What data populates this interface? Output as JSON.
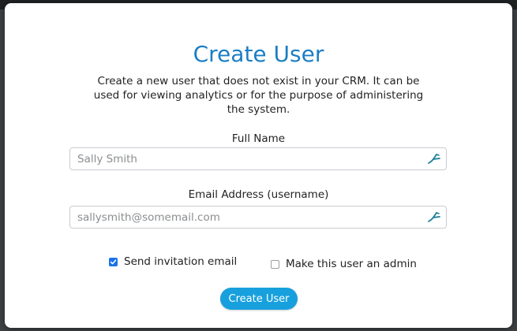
{
  "dialog": {
    "title": "Create User",
    "description": "Create a new user that does not exist in your CRM. It can be used for viewing analytics or for the purpose of administering the system."
  },
  "form": {
    "full_name": {
      "label": "Full Name",
      "placeholder": "Sally Smith",
      "value": "",
      "icon": "autofill-icon"
    },
    "email": {
      "label": "Email Address (username)",
      "placeholder": "sallysmith@somemail.com",
      "value": "",
      "icon": "autofill-icon"
    },
    "send_invitation": {
      "label": "Send invitation email",
      "checked": true
    },
    "make_admin": {
      "label": "Make this user an admin",
      "checked": false
    },
    "submit_label": "Create User"
  },
  "colors": {
    "title": "#1c7ec3",
    "button": "#17a0dd",
    "checkbox_checked": "#1a73e8",
    "icon": "#1b7e9a"
  }
}
